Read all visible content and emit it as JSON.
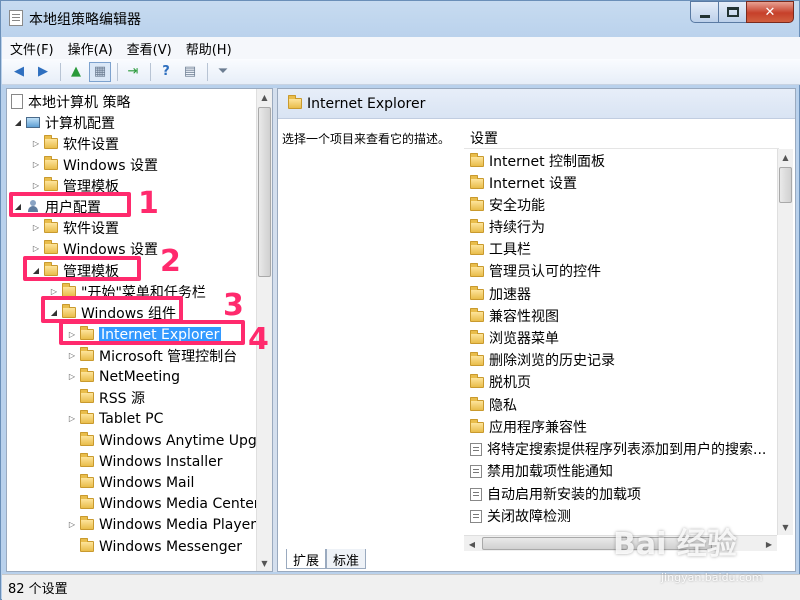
{
  "window": {
    "title": "本地组策略编辑器"
  },
  "menu": [
    "文件(F)",
    "操作(A)",
    "查看(V)",
    "帮助(H)"
  ],
  "tree": {
    "root": "本地计算机 策略",
    "computer_config": "计算机配置",
    "software_settings_1": "软件设置",
    "windows_settings_1": "Windows 设置",
    "admin_templates_1": "管理模板",
    "user_config": "用户配置",
    "software_settings_2": "软件设置",
    "windows_settings_2": "Windows 设置",
    "admin_templates_2": "管理模板",
    "start_menu": "\"开始\"菜单和任务栏",
    "windows_components": "Windows 组件",
    "components": [
      "Internet Explorer",
      "Microsoft 管理控制台",
      "NetMeeting",
      "RSS 源",
      "Tablet PC",
      "Windows Anytime Upgrade",
      "Windows Installer",
      "Windows Mail",
      "Windows Media Center",
      "Windows Media Player",
      "Windows Messenger"
    ]
  },
  "annotations": [
    "1",
    "2",
    "3",
    "4"
  ],
  "right": {
    "header": "Internet Explorer",
    "description": "选择一个项目来查看它的描述。",
    "column_header": "设置",
    "folders": [
      "Internet 控制面板",
      "Internet 设置",
      "安全功能",
      "持续行为",
      "工具栏",
      "管理员认可的控件",
      "加速器",
      "兼容性视图",
      "浏览器菜单",
      "删除浏览的历史记录",
      "脱机页",
      "隐私",
      "应用程序兼容性"
    ],
    "settings": [
      "将特定搜索提供程序列表添加到用户的搜索...",
      "禁用加载项性能通知",
      "自动启用新安装的加载项",
      "关闭故障检测"
    ],
    "tabs": [
      "扩展",
      "标准"
    ]
  },
  "status": "82 个设置",
  "watermark": {
    "brand": "Bai 经验",
    "url": "jingyan.baidu.com"
  }
}
